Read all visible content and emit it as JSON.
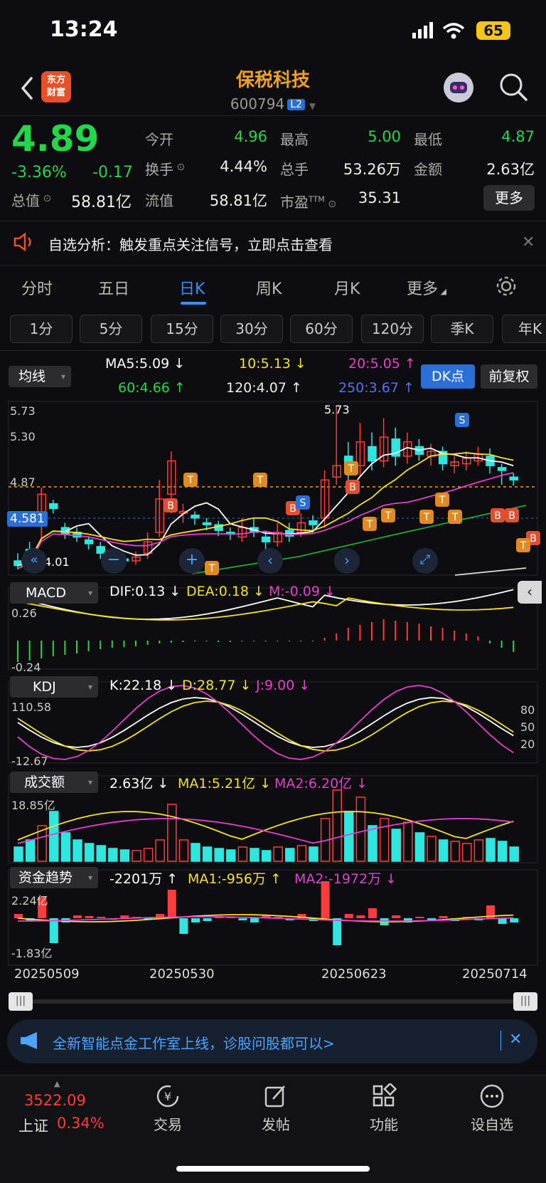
{
  "status": {
    "time": "13:24",
    "battery": "65"
  },
  "header": {
    "app_logo": "东方财富",
    "stock_name": "保税科技",
    "stock_code": "600794",
    "level": "L2"
  },
  "quote": {
    "price": "4.89",
    "change_pct": "-3.36%",
    "change": "-0.17",
    "open_label": "今开",
    "open": "4.96",
    "high_label": "最高",
    "high": "5.00",
    "low_label": "最低",
    "low": "4.87",
    "turnover_label": "换手",
    "turnover": "4.44%",
    "volume_label": "总手",
    "volume": "53.26万",
    "amount_label": "金额",
    "amount": "2.63亿",
    "total_cap_label": "总值",
    "total_cap": "58.81亿",
    "float_cap_label": "流值",
    "float_cap": "58.81亿",
    "pe_label": "市盈",
    "pe_sup": "TTM",
    "pe": "35.31",
    "more_label": "更多"
  },
  "alert": {
    "text": "自选分析：触发重点关注信号，立即点击查看"
  },
  "period_tabs": [
    "分时",
    "五日",
    "日K",
    "周K",
    "月K",
    "更多"
  ],
  "minute_tabs": [
    "1分",
    "5分",
    "15分",
    "30分",
    "60分",
    "120分",
    "季K",
    "年K"
  ],
  "ma": {
    "dropdown": "均线",
    "ma5": "MA5:5.09 ↓",
    "ma10": "10:5.13 ↓",
    "ma20": "20:5.05 ↑",
    "ma60": "60:4.66 ↑",
    "ma120": "120:4.07 ↑",
    "ma250": "250:3.67 ↑",
    "dk_label": "DK点",
    "fuquan_label": "前复权",
    "y_top": "5.73",
    "y_mid": "5.30",
    "y_low": "4.87",
    "cur_price": "4.581",
    "max_label": "5.73",
    "min_label": "4.01"
  },
  "macd": {
    "dropdown": "MACD",
    "dif": "DIF:0.13 ↓",
    "dea": "DEA:0.18 ↓",
    "m": "M:-0.09 ↓",
    "y_top": "0.26",
    "y_bot": "-0.24"
  },
  "kdj": {
    "dropdown": "KDJ",
    "k": "K:22.18 ↓",
    "d": "D:28.77 ↓",
    "j": "J:9.00 ↓",
    "y_top": "110.58",
    "y_bot": "-12.67",
    "r80": "80",
    "r50": "50",
    "r20": "20"
  },
  "amount_panel": {
    "dropdown": "成交额",
    "val": "2.63亿 ↓",
    "ma1": "MA1:5.21亿 ↓",
    "ma2": "MA2:6.20亿 ↓",
    "y_top": "18.85亿"
  },
  "fund_panel": {
    "dropdown": "资金趋势",
    "val": "-2201万 ↑",
    "ma1": "MA1:-956万 ↑",
    "ma2": "MA2:-1972万 ↓",
    "y_top": "2.24亿",
    "y_bot": "-1.83亿"
  },
  "dates": [
    "20250509",
    "20250530",
    "20250623",
    "20250714"
  ],
  "banner": {
    "text": "全新智能点金工作室上线，诊股问股都可以>"
  },
  "bottom_nav": {
    "index_value": "3522.09",
    "index_name": "上证",
    "index_pct": "0.34%",
    "items": [
      "交易",
      "发帖",
      "功能",
      "设自选"
    ]
  },
  "colors": {
    "up": "#ff3b3b",
    "down": "#22d84a",
    "candle_down": "#2ee6e0",
    "accent": "#3a8ff0"
  }
}
